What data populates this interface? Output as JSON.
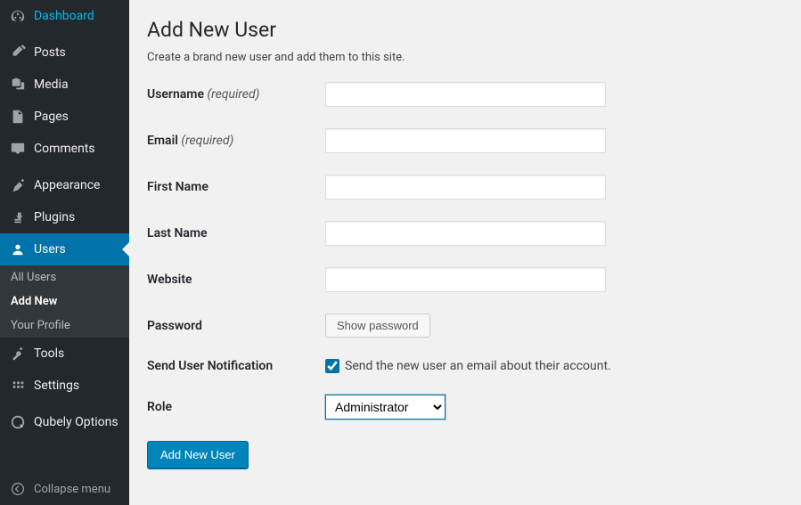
{
  "sidebar": {
    "items": [
      {
        "label": "Dashboard",
        "icon": "dashboard-icon"
      },
      {
        "label": "Posts",
        "icon": "posts-icon"
      },
      {
        "label": "Media",
        "icon": "media-icon"
      },
      {
        "label": "Pages",
        "icon": "pages-icon"
      },
      {
        "label": "Comments",
        "icon": "comments-icon"
      },
      {
        "label": "Appearance",
        "icon": "appearance-icon"
      },
      {
        "label": "Plugins",
        "icon": "plugins-icon"
      },
      {
        "label": "Users",
        "icon": "users-icon"
      },
      {
        "label": "Tools",
        "icon": "tools-icon"
      },
      {
        "label": "Settings",
        "icon": "settings-icon"
      },
      {
        "label": "Qubely Options",
        "icon": "qubely-icon"
      }
    ],
    "subitems": [
      {
        "label": "All Users"
      },
      {
        "label": "Add New"
      },
      {
        "label": "Your Profile"
      }
    ],
    "collapse_label": "Collapse menu"
  },
  "main": {
    "title": "Add New User",
    "subtitle": "Create a brand new user and add them to this site.",
    "fields": {
      "username": {
        "label": "Username",
        "required": "(required)"
      },
      "email": {
        "label": "Email",
        "required": "(required)"
      },
      "first_name": {
        "label": "First Name"
      },
      "last_name": {
        "label": "Last Name"
      },
      "website": {
        "label": "Website"
      },
      "password": {
        "label": "Password",
        "button": "Show password"
      },
      "notification": {
        "label": "Send User Notification",
        "checkbox_label": "Send the new user an email about their account."
      },
      "role": {
        "label": "Role",
        "selected": "Administrator"
      }
    },
    "submit_label": "Add New User"
  }
}
